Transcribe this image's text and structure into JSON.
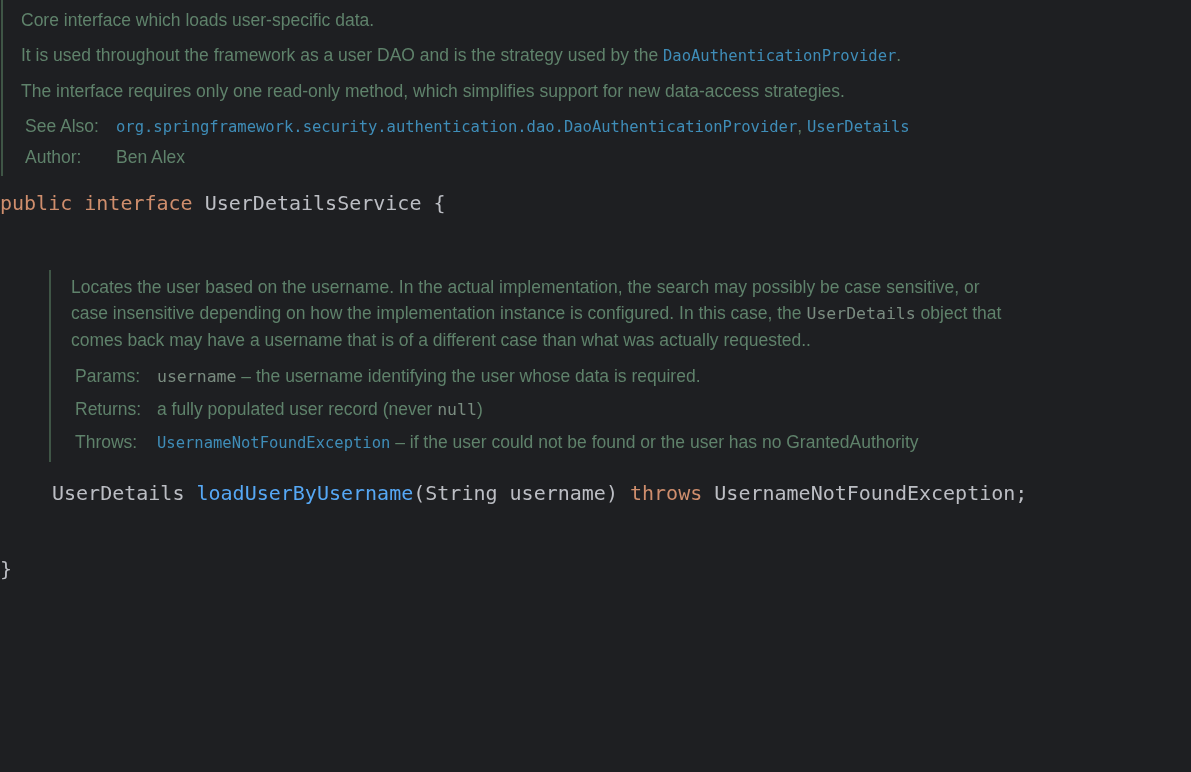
{
  "blocks": [
    {
      "kind": "doc",
      "paragraphs": [
        [
          {
            "kind": "text",
            "text": "Core interface which loads user-specific data."
          }
        ],
        [
          {
            "kind": "text",
            "text": "It is used throughout the framework as a user DAO and is the strategy used by the "
          },
          {
            "kind": "link",
            "text": "DaoAuthenticationProvider"
          },
          {
            "kind": "text",
            "text": "."
          }
        ],
        [
          {
            "kind": "text",
            "text": "The interface requires only one read-only method, which simplifies support for new data-access strategies."
          }
        ]
      ],
      "tags": [
        {
          "label": "See Also:",
          "value": [
            {
              "kind": "link",
              "text": "org.springframework.security.authentication.dao.DaoAuthenticationProvider"
            },
            {
              "kind": "text",
              "text": ", "
            },
            {
              "kind": "link",
              "text": "UserDetails"
            }
          ]
        },
        {
          "label": "Author:",
          "value": [
            {
              "kind": "text",
              "text": "Ben Alex"
            }
          ]
        }
      ]
    },
    {
      "kind": "code",
      "tokens": [
        {
          "kind": "keyword",
          "text": "public interface "
        },
        {
          "kind": "plain",
          "text": "UserDetailsService {"
        }
      ]
    },
    {
      "kind": "doc",
      "paragraphs": [
        [
          {
            "kind": "text",
            "text": "Locates the user based on the username. In the actual implementation, the search may possibly be case sensitive, or case insensitive depending on how the implementation instance is configured. In this case, the "
          },
          {
            "kind": "code",
            "text": "UserDetails"
          },
          {
            "kind": "text",
            "text": " object that comes back may have a username that is of a different case than what was actually requested.."
          }
        ]
      ],
      "tags": [
        {
          "label": "Params:",
          "value": [
            {
              "kind": "code",
              "text": "username"
            },
            {
              "kind": "text",
              "text": " – the username identifying the user whose data is required."
            }
          ]
        },
        {
          "label": "Returns:",
          "value": [
            {
              "kind": "text",
              "text": "a fully populated user record (never "
            },
            {
              "kind": "code",
              "text": "null"
            },
            {
              "kind": "text",
              "text": ")"
            }
          ]
        },
        {
          "label": "Throws:",
          "value": [
            {
              "kind": "link",
              "text": "UsernameNotFoundException"
            },
            {
              "kind": "text",
              "text": " – if the user could not be found or the user has no GrantedAuthority"
            }
          ]
        }
      ]
    },
    {
      "kind": "code",
      "tokens": [
        {
          "kind": "plain",
          "text": "UserDetails "
        },
        {
          "kind": "method",
          "text": "loadUserByUsername"
        },
        {
          "kind": "plain",
          "text": "(String username) "
        },
        {
          "kind": "keyword",
          "text": "throws "
        },
        {
          "kind": "plain",
          "text": "UsernameNotFoundException;"
        }
      ]
    },
    {
      "kind": "code",
      "tokens": [
        {
          "kind": "plain",
          "text": "}"
        }
      ]
    }
  ]
}
